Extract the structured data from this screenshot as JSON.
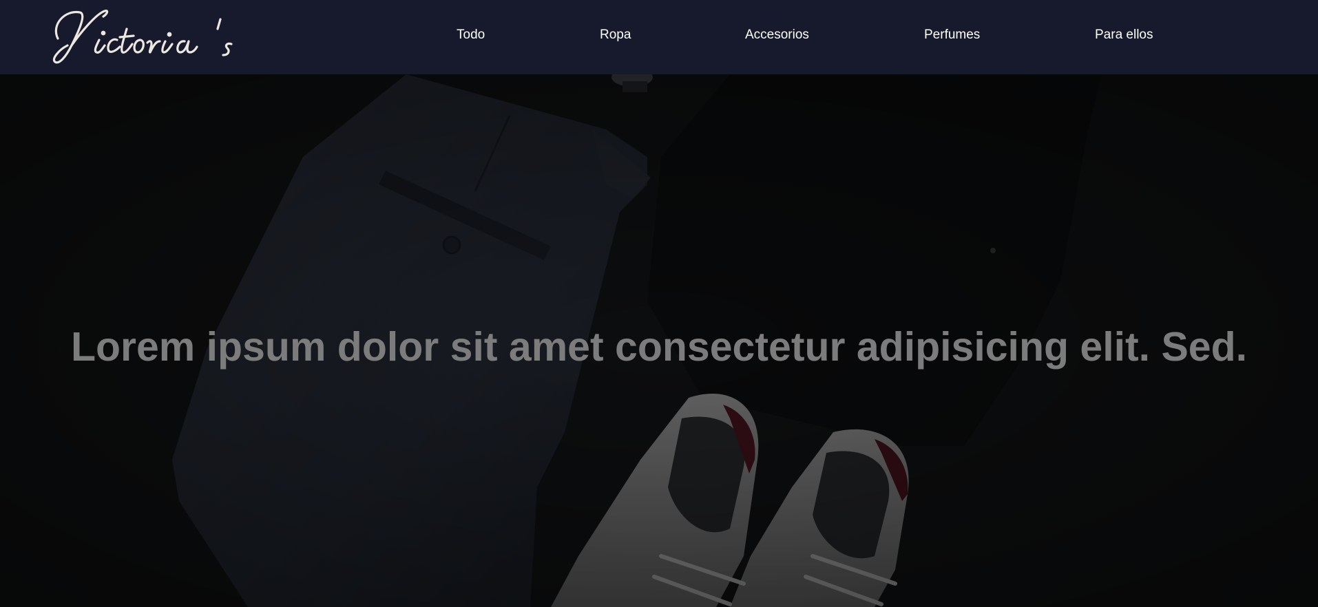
{
  "brand": {
    "logo_text": "Victoria 's"
  },
  "nav": {
    "items": [
      {
        "label": "Todo"
      },
      {
        "label": "Ropa"
      },
      {
        "label": "Accesorios"
      },
      {
        "label": "Perfumes"
      },
      {
        "label": "Para ellos"
      }
    ]
  },
  "hero": {
    "heading": "Lorem ipsum dolor sit amet consectetur adipisicing elit. Sed.",
    "image_subject": "flat-lay of folded grey trousers, dark shirt, wristwatch and white sneakers"
  },
  "colors": {
    "navbar_bg": "#161a2c",
    "nav_text": "#ffffff",
    "hero_text": "#7c7c7d",
    "hero_overlay": "#111214"
  }
}
